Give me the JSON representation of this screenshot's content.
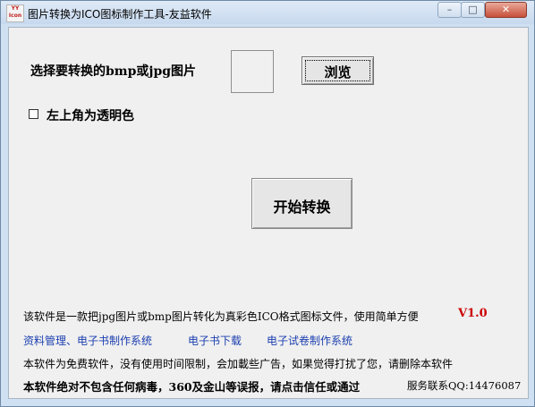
{
  "window": {
    "title": "图片转换为ICO图标制作工具-友益软件",
    "icon_text": "YY Icon",
    "controls": {
      "minimize": "–",
      "maximize": "□",
      "close": "✕"
    }
  },
  "main": {
    "select_label": "选择要转换的bmp或jpg图片",
    "browse_label": "浏览",
    "checkbox_label": "左上角为透明色",
    "checkbox_checked": false,
    "start_label": "开始转换"
  },
  "footer": {
    "description": "该软件是一款把jpg图片或bmp图片转化为真彩色ICO格式图标文件，使用简单方便",
    "version": "V1.0",
    "links": [
      "资料管理、电子书制作系统",
      "电子书下载",
      "电子试卷制作系统"
    ],
    "free_notice": "本软件为免费软件，没有使用时间限制，会加載些广告，如果觉得打扰了您，请删除本软件",
    "virus_notice": "本软件绝对不包含任何病毒，360及金山等误报，请点击信任或通过",
    "contact": "服务联系QQ:14476087"
  }
}
